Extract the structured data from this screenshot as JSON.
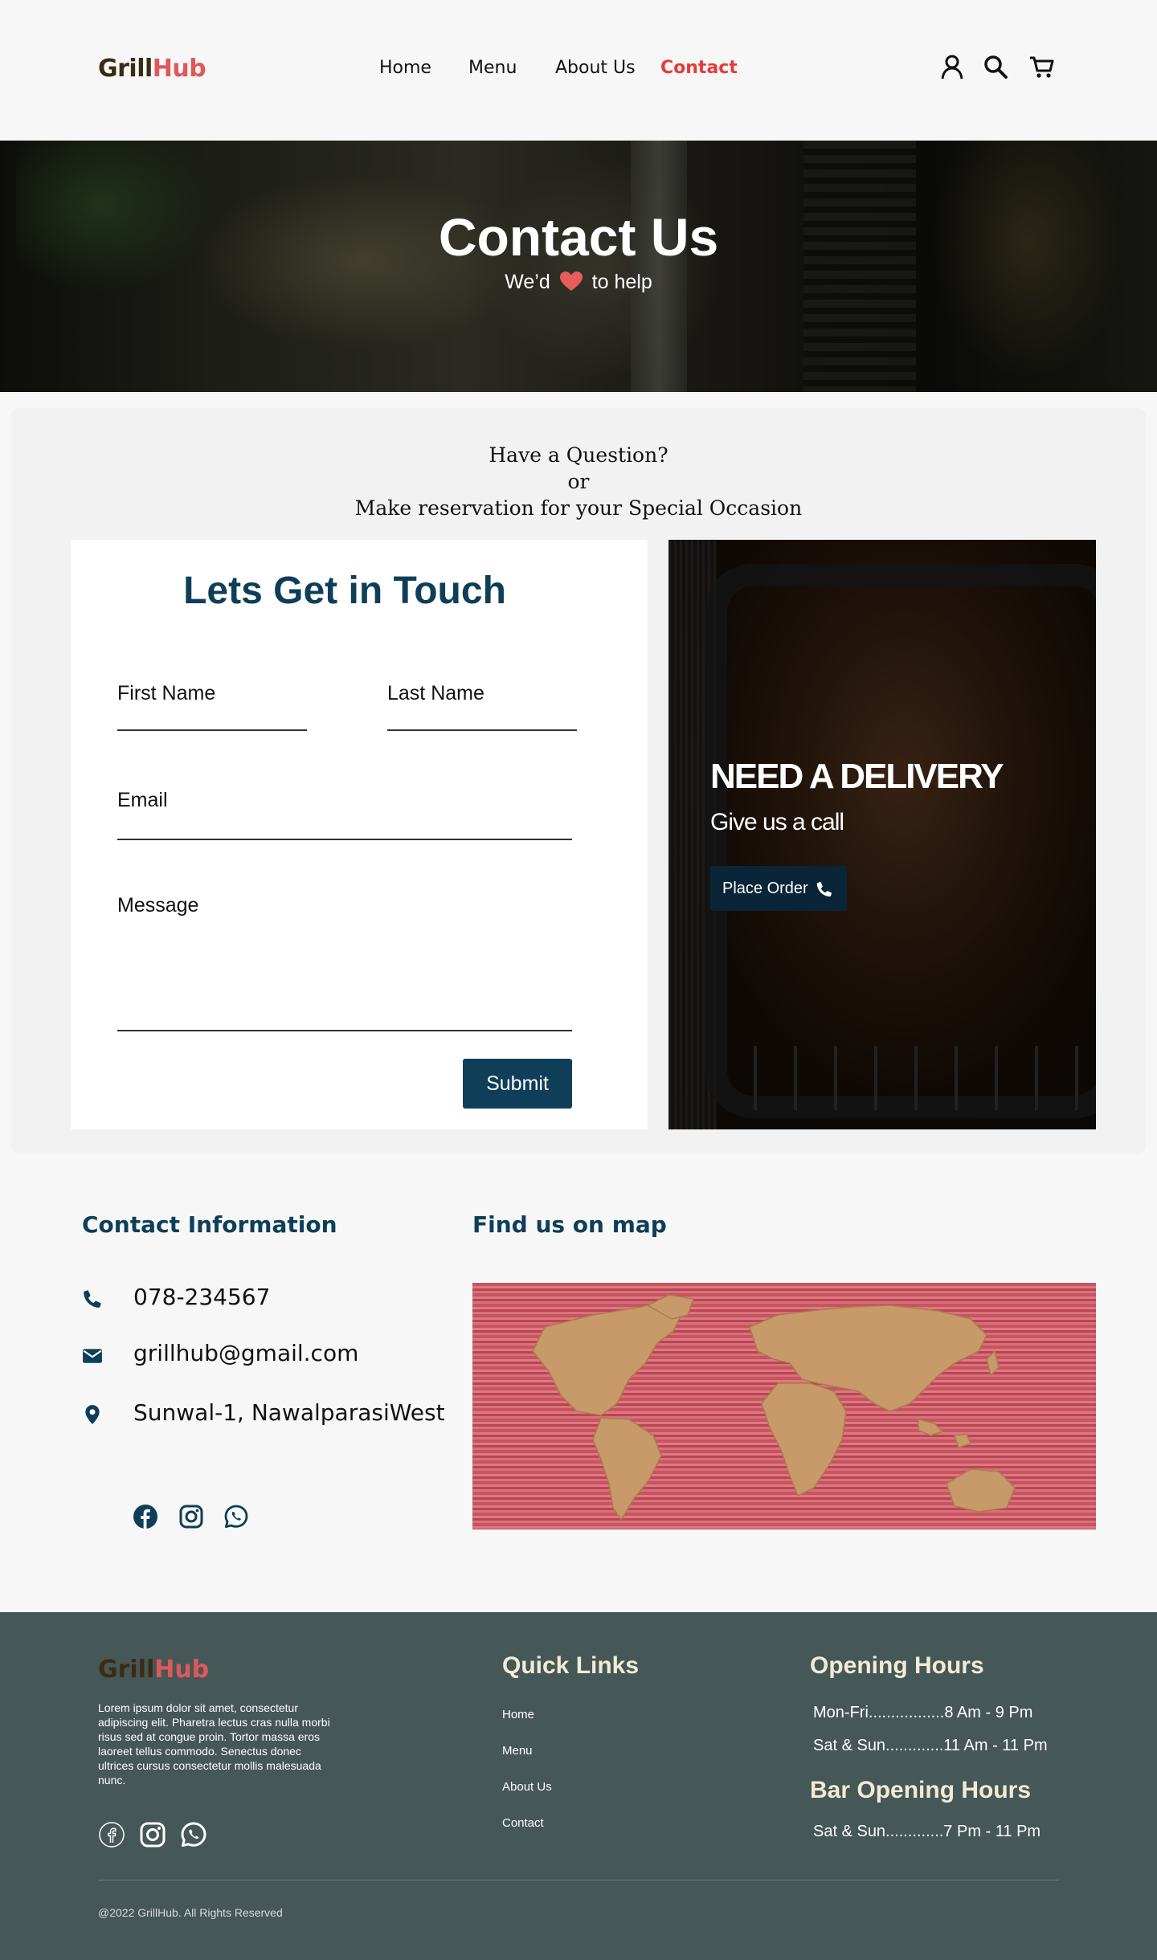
{
  "brand": {
    "name_part1": "Grill",
    "name_part2": "Hub",
    "accent": "#e0585a",
    "primary": "#0e3e58"
  },
  "nav": {
    "items": [
      {
        "label": "Home"
      },
      {
        "label": "Menu"
      },
      {
        "label": "About Us"
      },
      {
        "label": "Contact",
        "active": true
      }
    ],
    "icons": [
      "user-icon",
      "search-icon",
      "cart-icon"
    ]
  },
  "hero": {
    "title": "Contact Us",
    "tagline_before": "We’d",
    "tagline_after": "to help",
    "tagline_icon": "heart-icon"
  },
  "intro": {
    "line1": "Have a Question?",
    "line2": "or",
    "line3": "Make reservation for your Special Occasion"
  },
  "form": {
    "title": "Lets Get in Touch",
    "first_name_label": "First Name",
    "last_name_label": "Last Name",
    "email_label": "Email",
    "message_label": "Message",
    "submit_label": "Submit"
  },
  "delivery": {
    "heading": "NEED A DELIVERY",
    "subheading": "Give us a call",
    "button_label": "Place Order",
    "button_icon": "phone-icon"
  },
  "contact_info": {
    "title": "Contact Information",
    "phone": "078-234567",
    "email": "grillhub@gmail.com",
    "address": "Sunwal-1, NawalparasiWest",
    "icons": [
      "phone-icon",
      "mail-icon",
      "location-icon"
    ],
    "social": [
      "facebook-icon",
      "instagram-icon",
      "whatsapp-icon"
    ]
  },
  "map": {
    "title": "Find us on map"
  },
  "footer": {
    "description": "Lorem ipsum dolor sit amet, consectetur adipiscing elit. Pharetra lectus cras nulla morbi risus sed at congue proin. Tortor massa eros laoreet tellus commodo. Senectus donec ultrices cursus consectetur mollis malesuada nunc.",
    "quick_links_title": "Quick Links",
    "quick_links": [
      "Home",
      "Menu",
      "About Us",
      "Contact"
    ],
    "opening_hours_title": "Opening Hours",
    "opening_hours": [
      "Mon-Fri.................8 Am - 9 Pm",
      "Sat & Sun.............11 Am - 11 Pm"
    ],
    "bar_hours_title": "Bar Opening Hours",
    "bar_hours": [
      "Sat & Sun.............7 Pm - 11 Pm"
    ],
    "copyright": "@2022 GrillHub. All Rights Reserved",
    "social": [
      "facebook-icon",
      "instagram-icon",
      "whatsapp-icon"
    ]
  }
}
